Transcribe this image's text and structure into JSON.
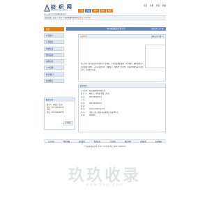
{
  "header": {
    "logo_text": "纺 织 网",
    "logo_url": "www.tex-net.com.cn",
    "tagline": "开心 买卖平台 纺织网站服务商",
    "top_links": [
      "首页",
      "注册",
      "登录",
      "帮助"
    ],
    "nav": [
      "产品",
      "企业",
      "求购",
      "商城",
      "展会"
    ],
    "breadcrumb_prefix": "您的位置：首页 > 企业 > 杭州纳通贸易有限公司 >",
    "breadcrumb_company": "公司介绍"
  },
  "sidebar": {
    "items": [
      "首页",
      "公司简介",
      "产品展示",
      "供求信息",
      "新闻动态",
      "资质证书",
      "人才招聘",
      "联系我们",
      "在线留言"
    ]
  },
  "contact_box": {
    "title": "联系方式",
    "lines": [
      "联系人：杨先生 (先生)",
      "电话：0571-82345*17",
      "手机：",
      "传真：0571-82345*16"
    ],
    "button": "在线留言"
  },
  "main": {
    "company_name": "杭州纳通贸易有限公司",
    "right_text": "您的位置 公司介绍",
    "intro_title": "公司简介",
    "more_link": "更多公司介绍>>",
    "intro_text": "本公司位于浙江杭州市区域滨江产业园区，主营纺织服装面料、化纤原料、辅料及相关产品的批发与零售。公司以诚信为本，质量第一，服务至上为宗旨，欢迎各界朋友来电洽谈合作，共创美好未来。"
  },
  "contact_panel": {
    "title": "联系我们",
    "rows": [
      {
        "k": "公司名称：",
        "v": "杭州纳通贸易有限公司"
      },
      {
        "k": "联 系 人：",
        "v": "杨先生 / 市场部  经理（先生）"
      },
      {
        "k": "电  话：",
        "v": "0571-82345*17"
      },
      {
        "k": "手  机：",
        "v": ""
      },
      {
        "k": "传  真：",
        "v": "0571-82345*16"
      },
      {
        "k": "邮  编：",
        "v": ""
      },
      {
        "k": "网  址：",
        "v": "www.hznatong.com"
      },
      {
        "k": "地  址：",
        "v": "中国 上海 上海市 杭州区滨江大道200 号"
      },
      {
        "k": "邮  编：",
        "v": "200000"
      }
    ]
  },
  "footer": {
    "links": [
      "关于我们",
      "网站地图",
      "联系我们",
      "服务条款",
      "广告服务",
      "网站导航",
      "付费服务",
      "在线客服"
    ],
    "copyright": "© 纺织网 版权所有 1997-2019 浙ICP证 浙B2-20080101"
  },
  "watermark": {
    "title": "玖玖收录",
    "url": "www.99sl.com"
  },
  "colors": {
    "accent": "#e47e14",
    "brand": "#1e3f7a",
    "panel": "#dfe7f2",
    "bar": "#5e86c2"
  }
}
